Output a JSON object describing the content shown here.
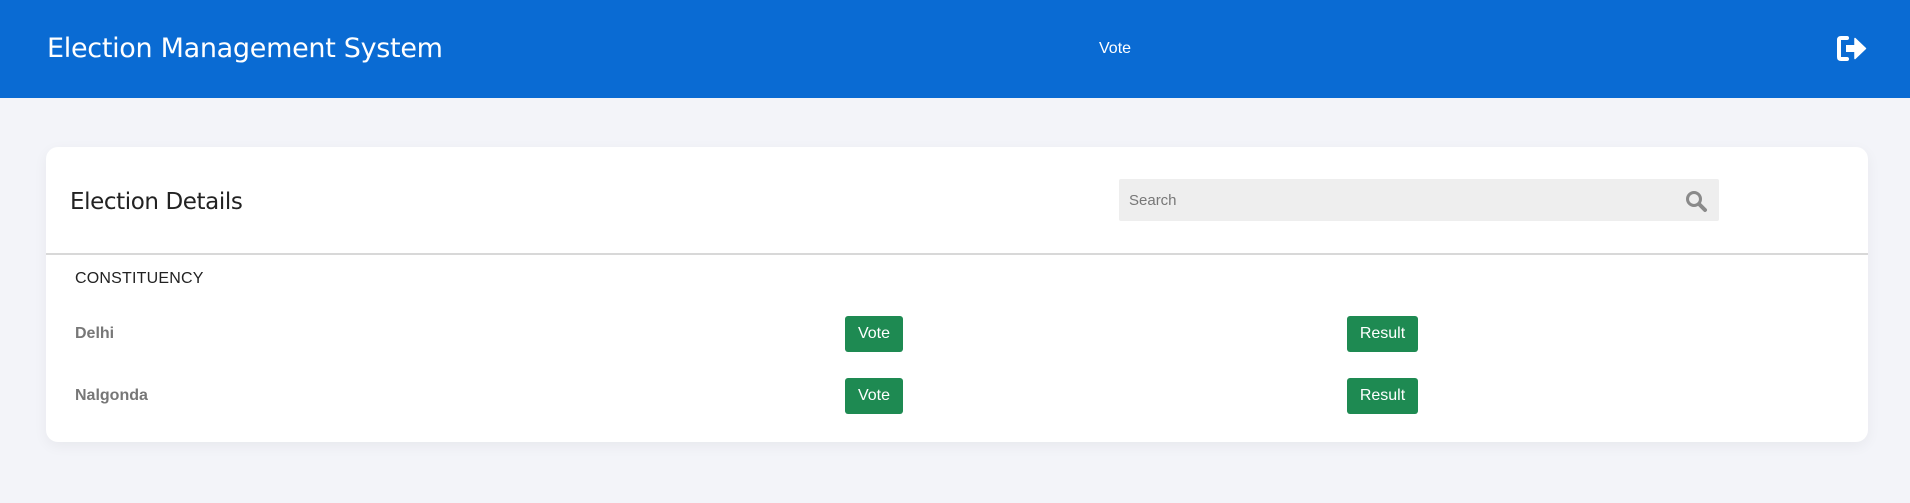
{
  "header": {
    "title": "Election Management System",
    "nav_vote": "Vote",
    "logout_icon": "sign-out-icon",
    "background": "#0a6bd3"
  },
  "card": {
    "title": "Election Details",
    "search": {
      "placeholder": "Search",
      "value": ""
    },
    "column_header": "CONSTITUENCY",
    "rows": [
      {
        "name": "Delhi",
        "vote_label": "Vote",
        "result_label": "Result"
      },
      {
        "name": "Nalgonda",
        "vote_label": "Vote",
        "result_label": "Result"
      }
    ]
  },
  "colors": {
    "button_green": "#1e8a52",
    "page_background": "#f3f4f9"
  }
}
